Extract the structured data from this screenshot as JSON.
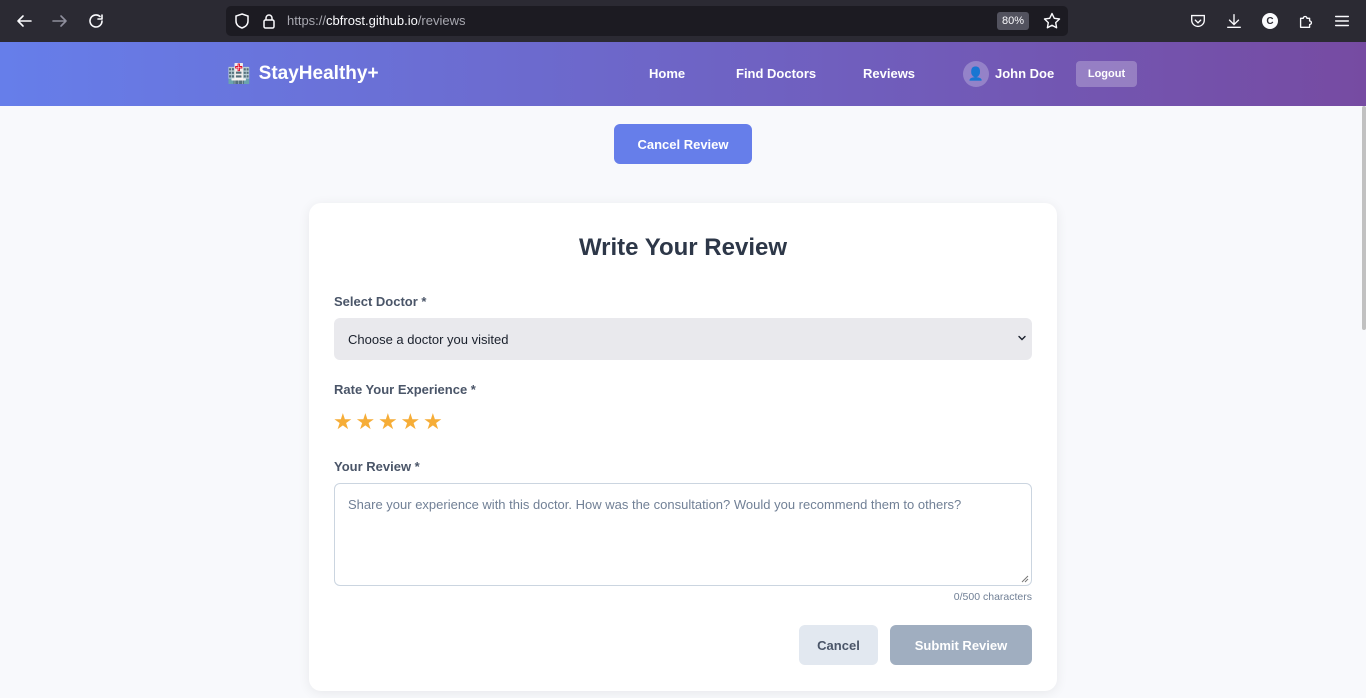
{
  "browser": {
    "url_prefix": "https://",
    "url_domain": "cbfrost.github.io",
    "url_path": "/reviews",
    "zoom": "80%",
    "account_initial": "C"
  },
  "header": {
    "brand": "StayHealthy+",
    "brand_icon": "hospital-icon",
    "nav": {
      "home": "Home",
      "find_doctors": "Find Doctors",
      "reviews": "Reviews"
    },
    "user_name": "John Doe",
    "logout_label": "Logout"
  },
  "main": {
    "cancel_review_label": "Cancel Review",
    "form": {
      "title": "Write Your Review",
      "doctor_label": "Select Doctor *",
      "doctor_selected": "Choose a doctor you visited",
      "rating_label": "Rate Your Experience *",
      "rating_stars": 5,
      "review_label": "Your Review *",
      "review_placeholder": "Share your experience with this doctor. How was the consultation? Would you recommend them to others?",
      "review_value": "",
      "char_count": "0/500 characters",
      "cancel_label": "Cancel",
      "submit_label": "Submit Review"
    }
  },
  "colors": {
    "header_gradient_start": "#667eea",
    "header_gradient_end": "#764ba2",
    "accent": "#667eea",
    "star": "#f6ad37",
    "submit_disabled": "#a0aec0"
  }
}
